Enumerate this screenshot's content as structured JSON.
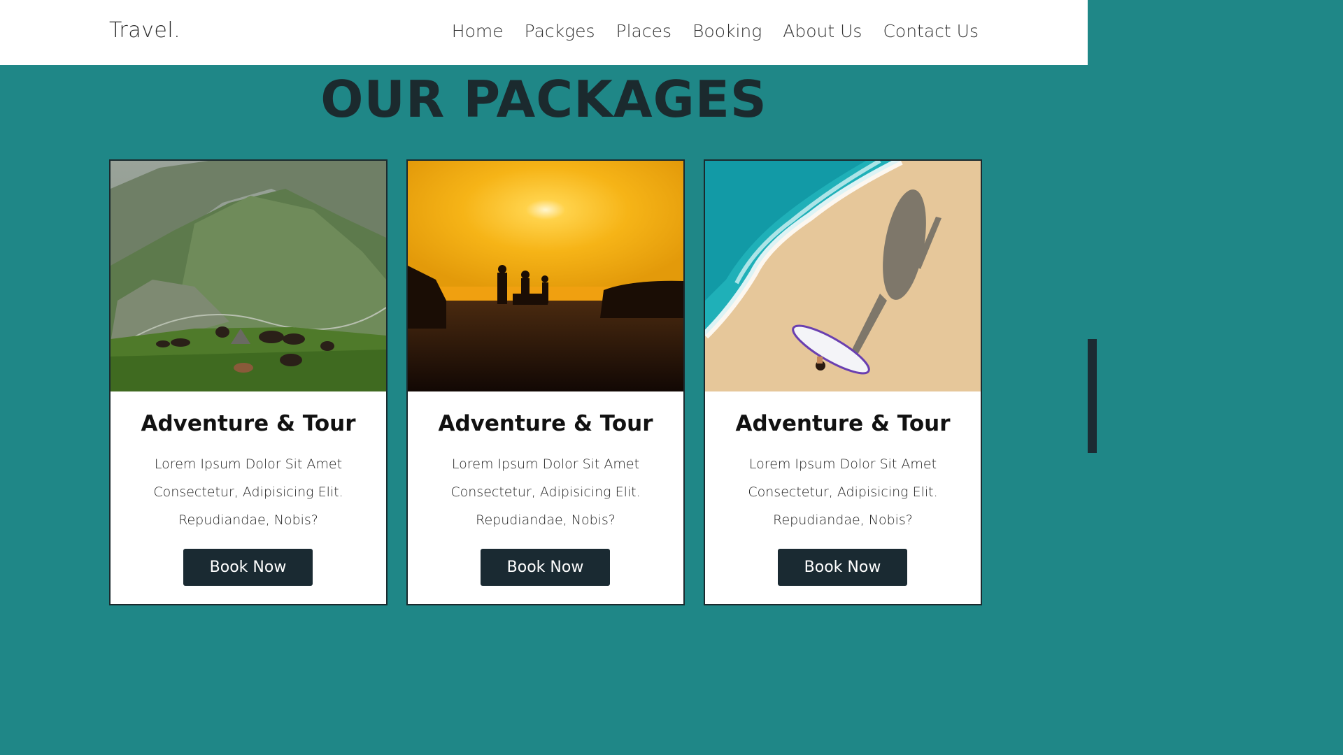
{
  "header": {
    "brand": "Travel.",
    "nav": [
      "Home",
      "Packges",
      "Places",
      "Booking",
      "About Us",
      "Contact Us"
    ]
  },
  "section": {
    "title": "OUR PACKAGES"
  },
  "cards": [
    {
      "image": "mountain-horses-image",
      "title": "Adventure & Tour",
      "lines": [
        "Lorem Ipsum Dolor Sit Amet",
        "Consectetur, Adipisicing Elit.",
        "Repudiandae, Nobis?"
      ],
      "button": "Book Now"
    },
    {
      "image": "sunset-silhouettes-image",
      "title": "Adventure & Tour",
      "lines": [
        "Lorem Ipsum Dolor Sit Amet",
        "Consectetur, Adipisicing Elit.",
        "Repudiandae, Nobis?"
      ],
      "button": "Book Now"
    },
    {
      "image": "beach-surfer-image",
      "title": "Adventure & Tour",
      "lines": [
        "Lorem Ipsum Dolor Sit Amet",
        "Consectetur, Adipisicing Elit.",
        "Repudiandae, Nobis?"
      ],
      "button": "Book Now"
    }
  ],
  "colors": {
    "background": "#1f8787",
    "button": "#1a2a32",
    "title": "#1b2a2e"
  }
}
